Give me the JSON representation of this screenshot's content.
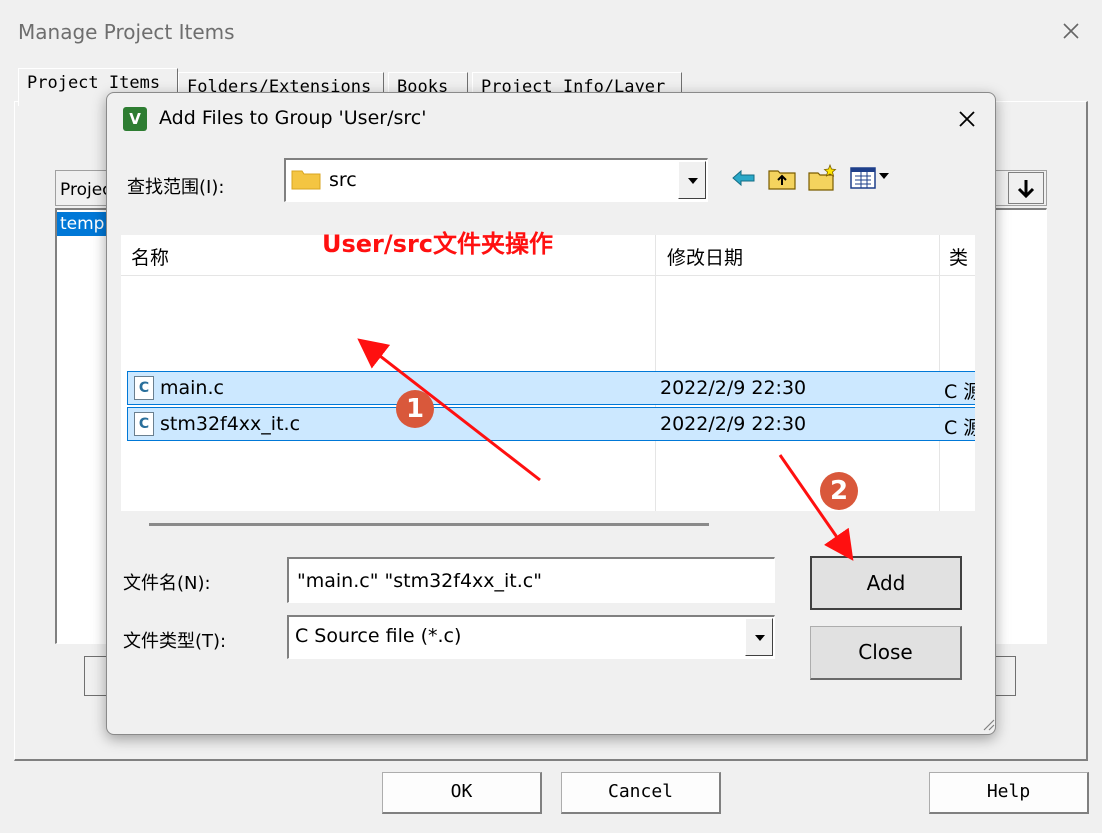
{
  "outer": {
    "title": "Manage Project Items",
    "tabs": [
      {
        "label": "Project Items"
      },
      {
        "label": "Folders/Extensions"
      },
      {
        "label": "Books"
      },
      {
        "label": "Project Info/Layer"
      }
    ],
    "list_header": "Projec",
    "list_selected": "templ",
    "buttons": {
      "ok": "OK",
      "cancel": "Cancel",
      "help": "Help"
    }
  },
  "dialog": {
    "title": "Add Files to Group 'User/src'",
    "look_in_label": "查找范围(I):",
    "look_in_value": "src",
    "columns": {
      "name": "名称",
      "date": "修改日期",
      "type": "类"
    },
    "files": [
      {
        "name": "main.c",
        "date": "2022/2/9 22:30",
        "type": "C 源"
      },
      {
        "name": "stm32f4xx_it.c",
        "date": "2022/2/9 22:30",
        "type": "C 源"
      }
    ],
    "file_name_label": "文件名(N):",
    "file_name_value": "\"main.c\" \"stm32f4xx_it.c\"",
    "file_type_label": "文件类型(T):",
    "file_type_value": "C Source file (*.c)",
    "add_button": "Add",
    "close_button": "Close"
  },
  "annotation": {
    "caption": "User/src文件夹操作",
    "step1": "1",
    "step2": "2",
    "color": "#ff1010"
  },
  "icons": {
    "app": "keil-uvision-icon",
    "file": "c-file-icon",
    "folder": "folder-icon"
  }
}
